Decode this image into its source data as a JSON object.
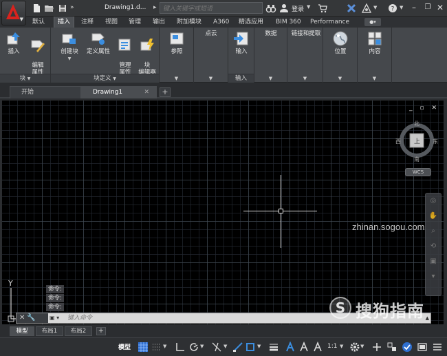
{
  "titlebar": {
    "doc_title": "Drawing1.d...",
    "title_arrow": "▸",
    "search_placeholder": "键入关键字或短语",
    "login": "登录",
    "help": "?"
  },
  "ribbon_tabs": [
    "默认",
    "插入",
    "注释",
    "视图",
    "管理",
    "输出",
    "附加模块",
    "A360",
    "精选应用",
    "BIM 360",
    "Performance"
  ],
  "ribbon": {
    "block_panel": {
      "label": "块",
      "insert": "插入",
      "edit_attr": "编辑\n属性"
    },
    "block_def_panel": {
      "label": "块定义",
      "create": "创建块",
      "define_attr": "定义属性",
      "manage_attr": "管理\n属性",
      "block_editor": "块\n编辑器"
    },
    "reference": "参照",
    "point_cloud": "点云",
    "import_panel": {
      "label": "输入",
      "button": "输入"
    },
    "data": "数据",
    "link_extract": "链接和提取",
    "location": "位置",
    "content": "内容"
  },
  "doc_tabs": [
    {
      "label": "开始"
    },
    {
      "label": "Drawing1"
    }
  ],
  "viewport": {
    "controls": "_ ▫ ✕",
    "compass": {
      "north": "北",
      "south": "南",
      "east": "东",
      "west": "西",
      "top_face": "上"
    },
    "wcs": "WCS"
  },
  "ucs": {
    "y_label": "Y"
  },
  "command": {
    "history": [
      "命令:",
      "命令:",
      "命令:"
    ],
    "placeholder": "键入命令"
  },
  "watermark": {
    "text": "搜狗指南",
    "domain": "zhinan.sogou.com"
  },
  "layout_tabs": [
    "模型",
    "布局1",
    "布局2"
  ],
  "statusbar": {
    "model": "模型",
    "scale": "1:1"
  }
}
